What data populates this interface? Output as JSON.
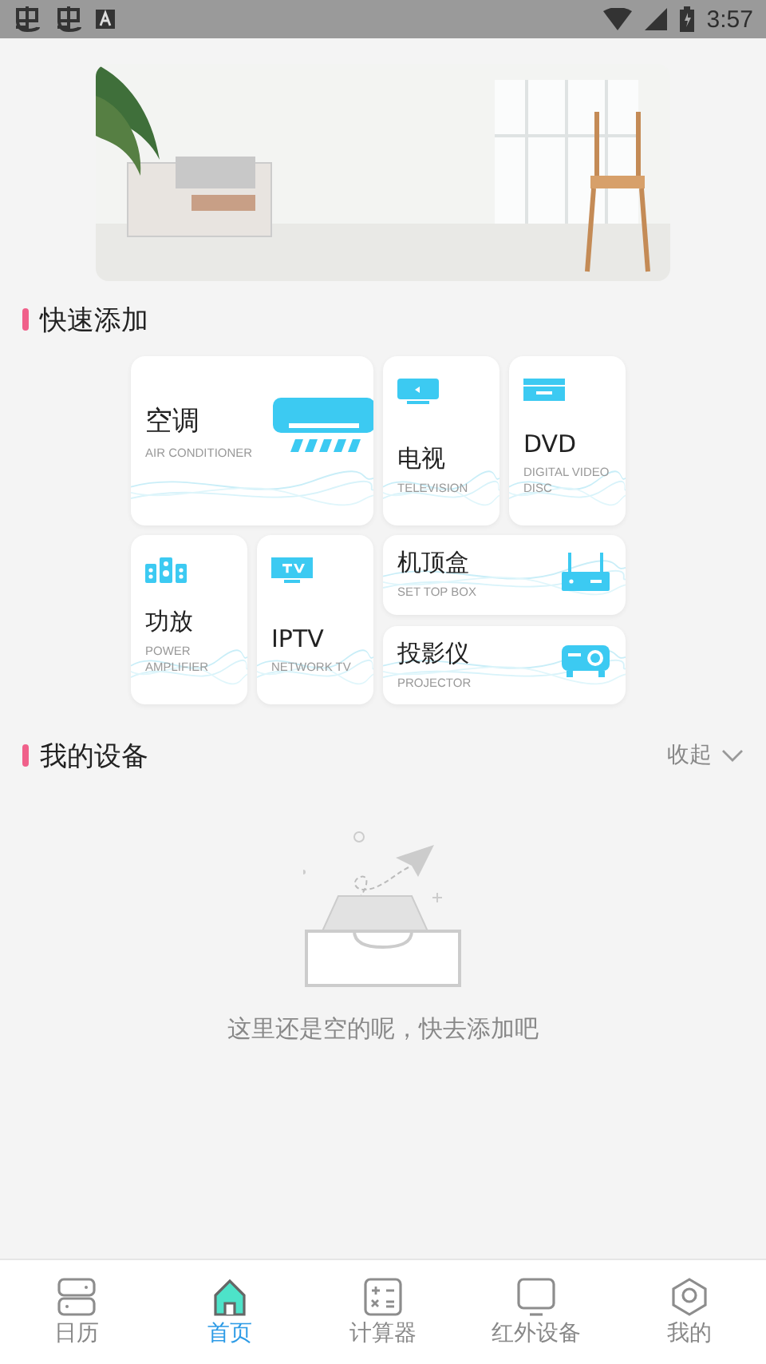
{
  "status_bar": {
    "time": "3:57"
  },
  "quick_add": {
    "title": "快速添加",
    "tiles": [
      {
        "kind": "large",
        "name": "空调",
        "subtitle": "AIR CONDITIONER"
      },
      {
        "kind": "small",
        "name": "电视",
        "subtitle": "TELEVISION"
      },
      {
        "kind": "small",
        "name": "DVD",
        "subtitle": "DIGITAL VIDEO DISC"
      },
      {
        "kind": "small",
        "name": "功放",
        "subtitle": "POWER AMPLIFIER"
      },
      {
        "kind": "small",
        "name": "IPTV",
        "subtitle": "NETWORK TV"
      },
      {
        "kind": "wide",
        "name": "机顶盒",
        "subtitle": "SET TOP BOX"
      },
      {
        "kind": "wide",
        "name": "投影仪",
        "subtitle": "PROJECTOR"
      }
    ]
  },
  "my_devices": {
    "title": "我的设备",
    "toggle": "收起",
    "empty_text": "这里还是空的呢，快去添加吧"
  },
  "nav": [
    {
      "label": "日历",
      "selected": false
    },
    {
      "label": "首页",
      "selected": true
    },
    {
      "label": "计算器",
      "selected": false
    },
    {
      "label": "红外设备",
      "selected": false
    },
    {
      "label": "我的",
      "selected": false
    }
  ]
}
